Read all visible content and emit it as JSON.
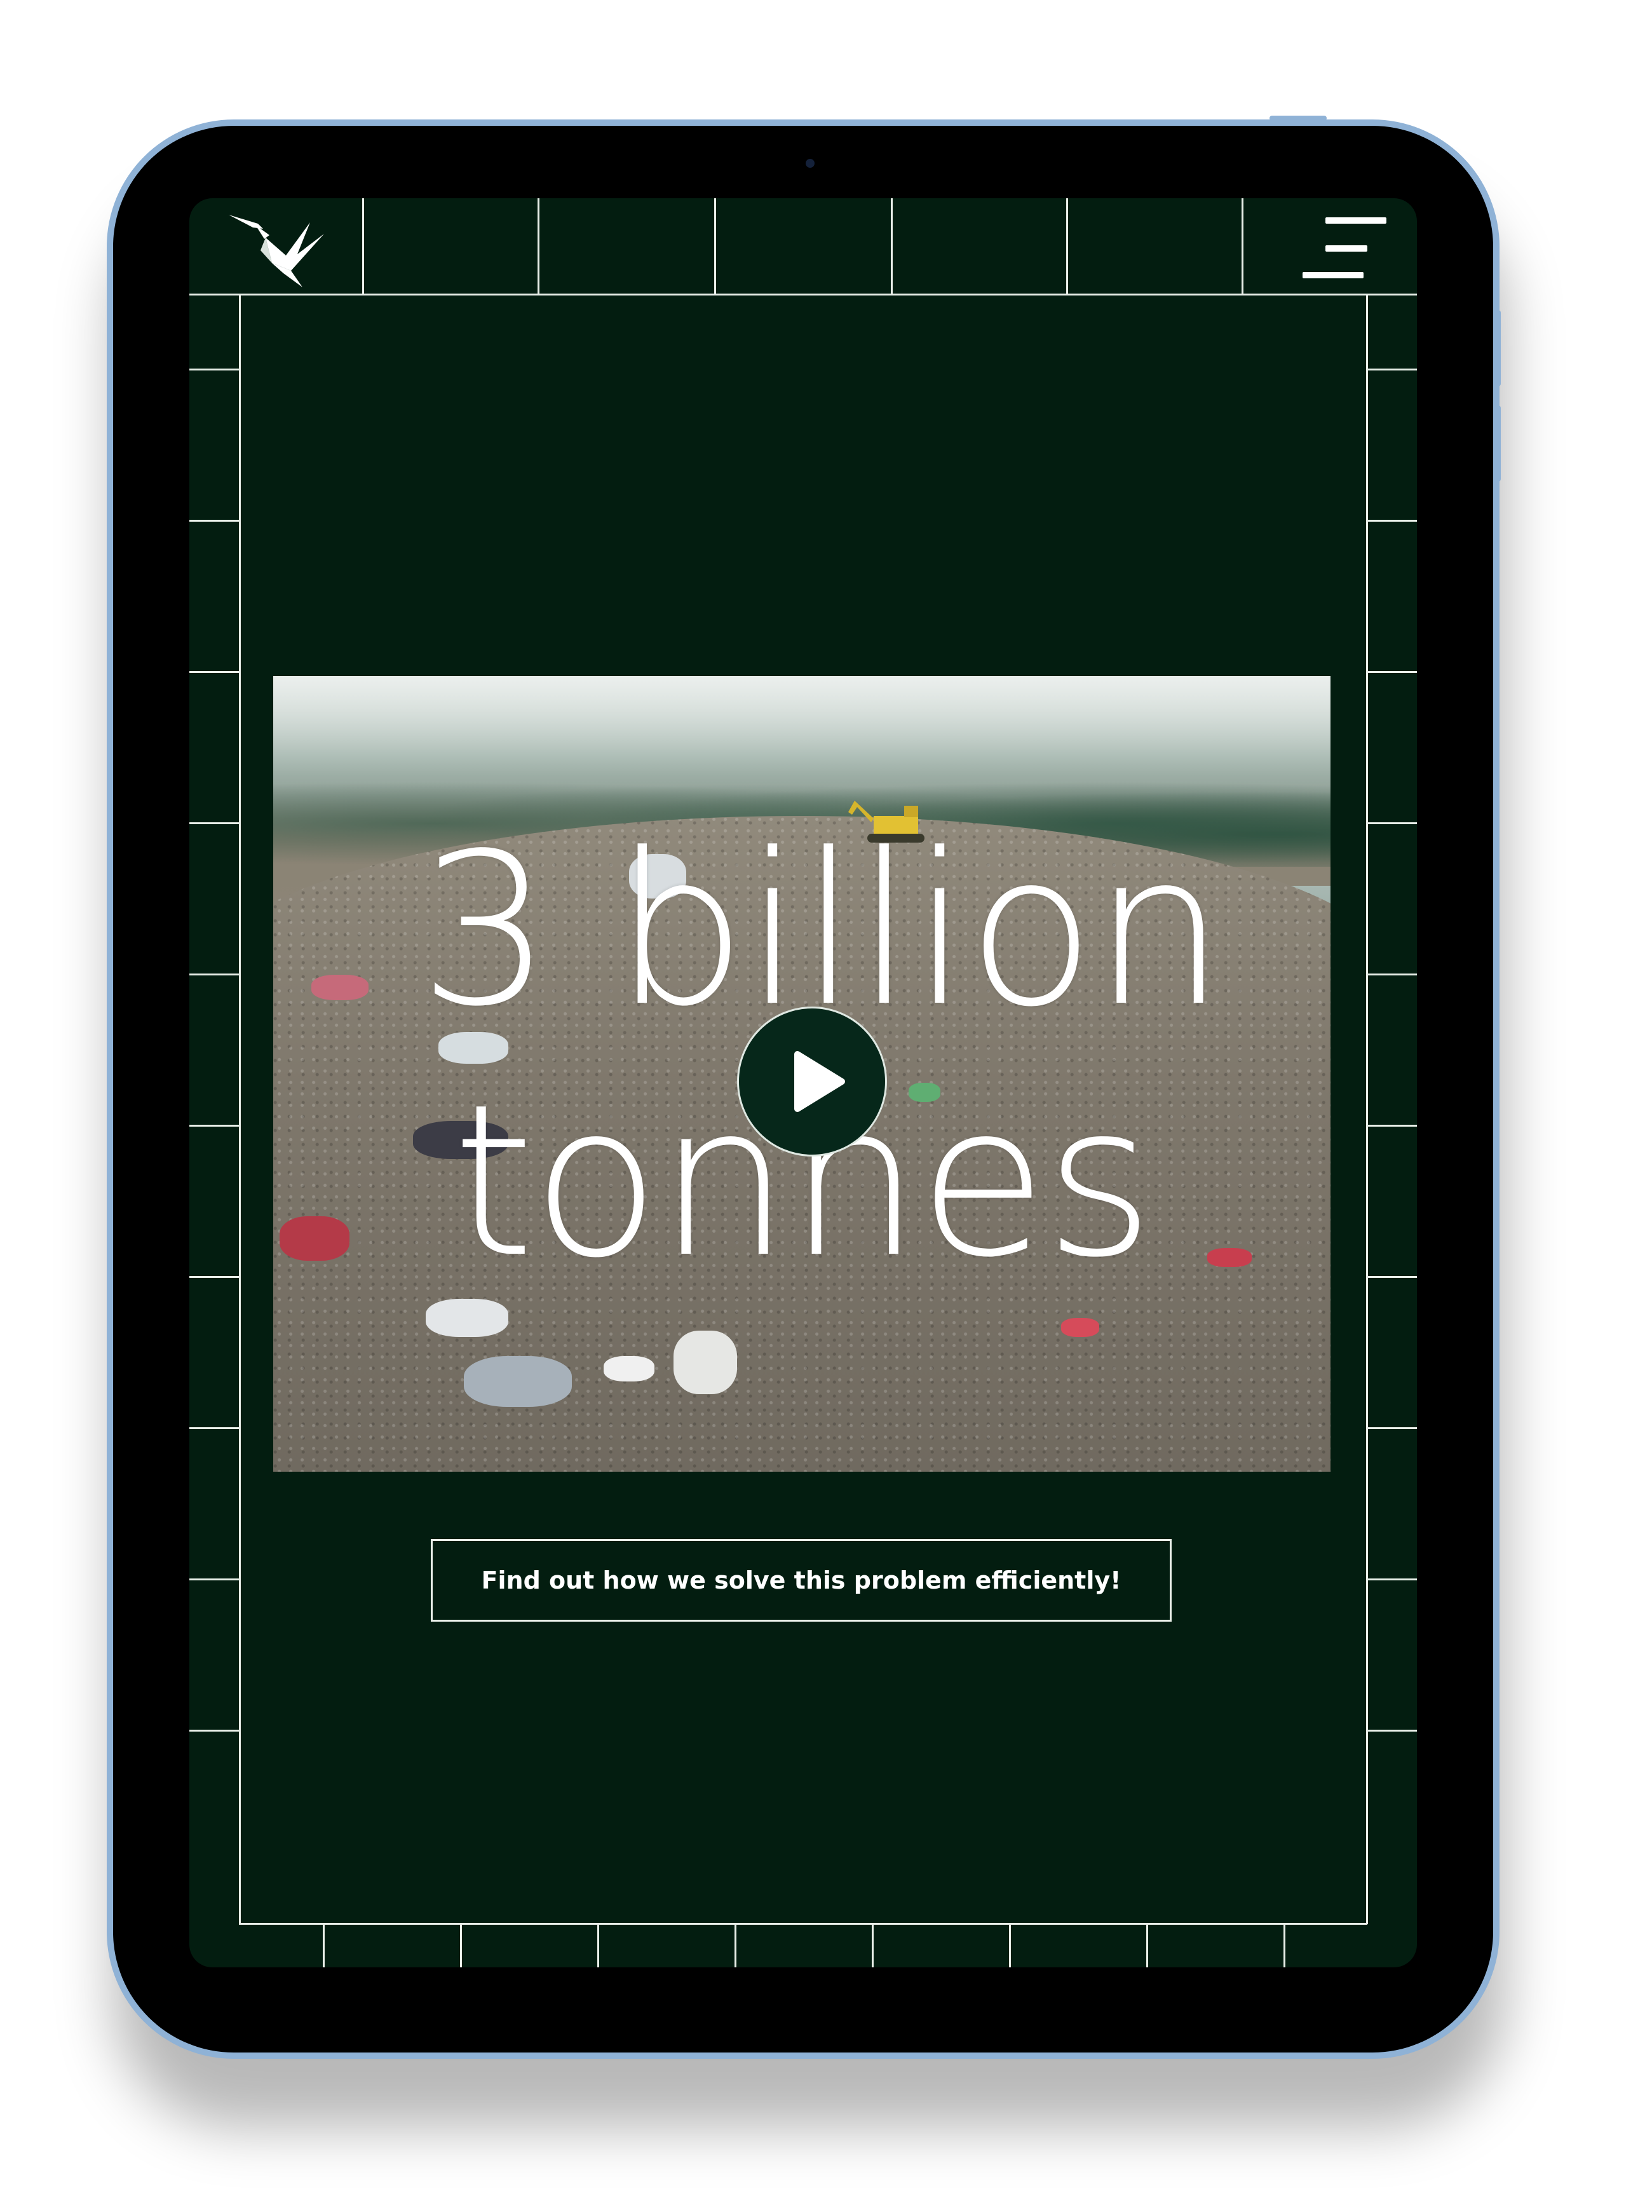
{
  "hero": {
    "line1": "3 billion",
    "line2": "tonnes"
  },
  "cta": {
    "label": "Find out how we solve this problem efficiently!"
  },
  "icons": {
    "logo": "crane-bird-logo-icon",
    "menu": "hamburger-menu-icon",
    "play": "play-icon"
  },
  "colors": {
    "background": "#031d10",
    "grid_lines": "#e9efe9",
    "text": "#ffffff",
    "play_button": "#06271a",
    "device_frame": "#8fb2d6"
  }
}
